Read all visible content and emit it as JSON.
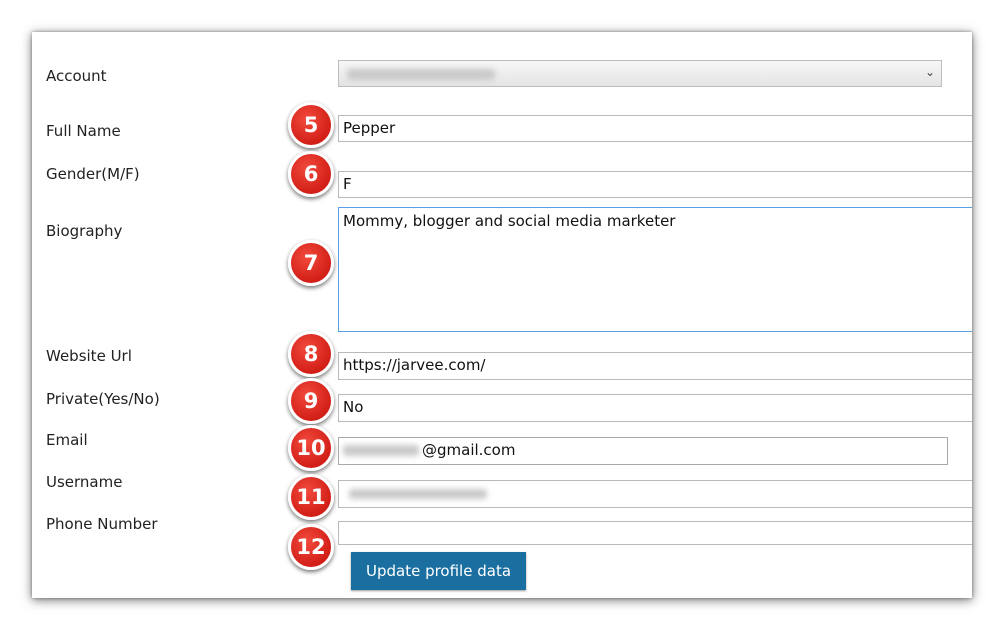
{
  "form": {
    "account": {
      "label": "Account",
      "value": ""
    },
    "full_name": {
      "label": "Full Name",
      "value": "Pepper",
      "marker": "5"
    },
    "gender": {
      "label": "Gender(M/F)",
      "value": "F",
      "marker": "6"
    },
    "biography": {
      "label": "Biography",
      "value": "Mommy, blogger and social media marketer",
      "marker": "7"
    },
    "website": {
      "label": "Website Url",
      "value": "https://jarvee.com/",
      "marker": "8"
    },
    "private": {
      "label": "Private(Yes/No)",
      "value": "No",
      "marker": "9"
    },
    "email": {
      "label": "Email",
      "value_suffix": "@gmail.com",
      "marker": "10"
    },
    "username": {
      "label": "Username",
      "value": "",
      "marker": "11"
    },
    "phone": {
      "label": "Phone Number",
      "value": "",
      "marker": "12"
    },
    "submit_label": "Update profile data"
  },
  "icons": {
    "dropdown": "chevron-down-icon"
  },
  "colors": {
    "marker": "#d92b21",
    "button": "#1a6fa0",
    "focus_border": "#5aa0e6"
  }
}
